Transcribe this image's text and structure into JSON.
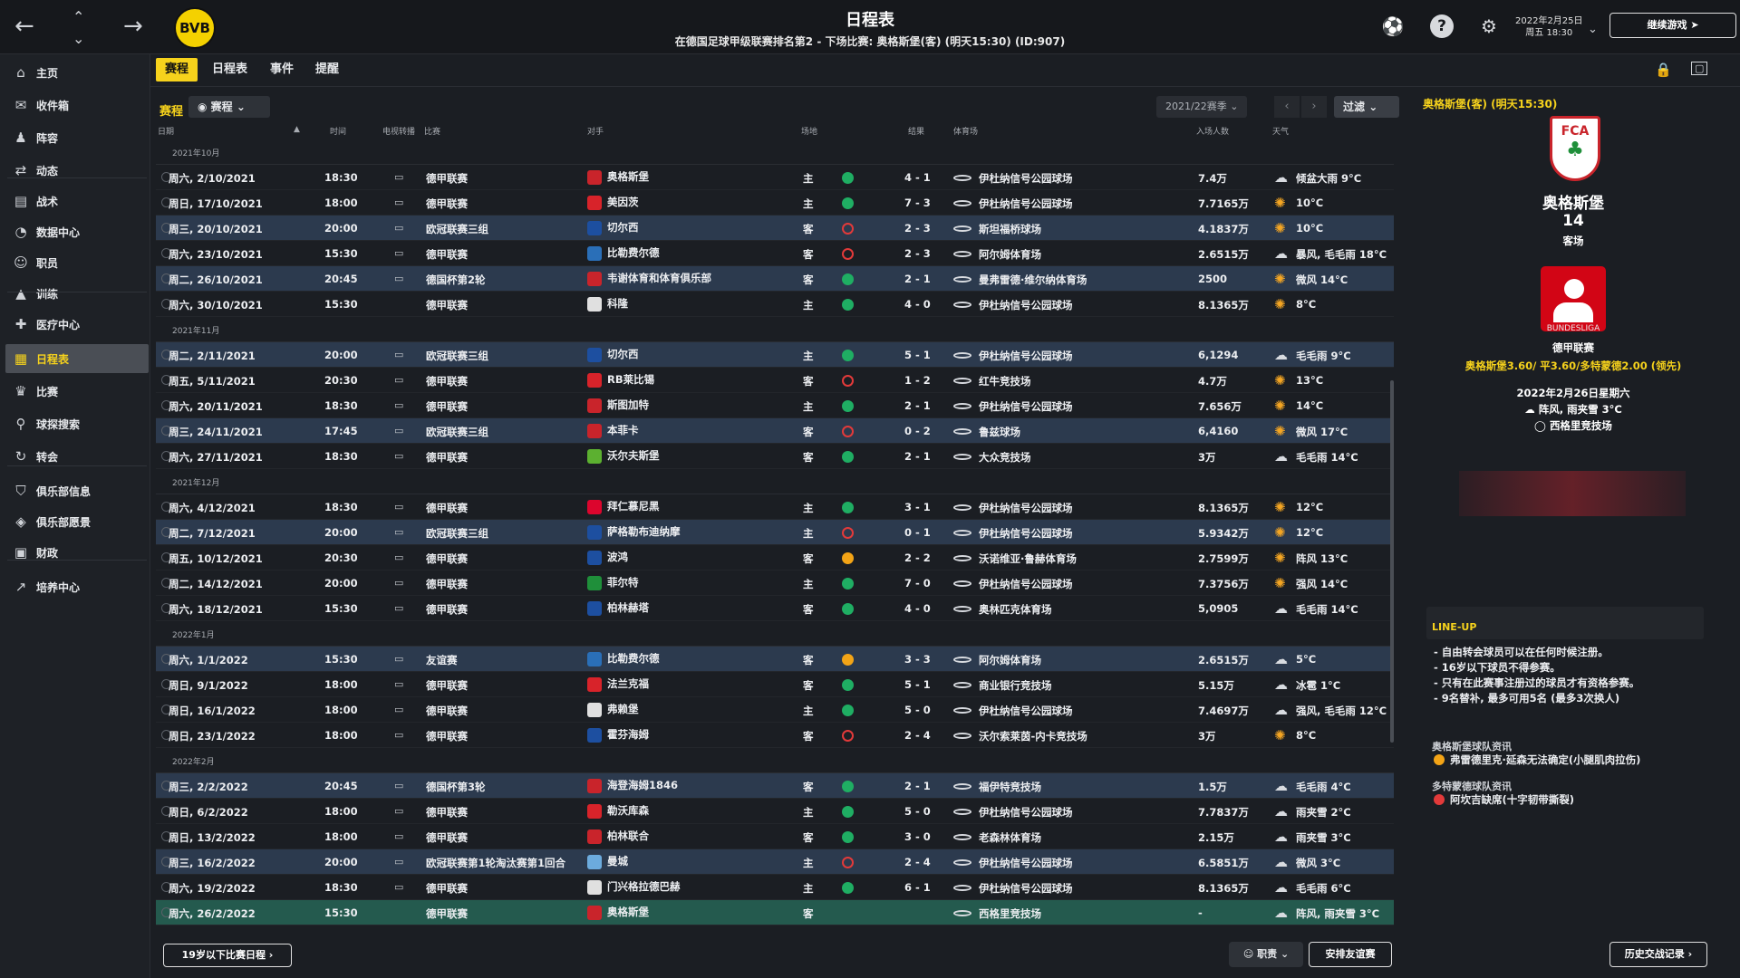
{
  "header": {
    "title": "日程表",
    "subtitle": "在德国足球甲级联赛排名第2 - 下场比赛: 奥格斯堡(客) (明天15:30) (ID:907)",
    "club_badge_text": "BVB",
    "game_date_line1": "2022年2月25日",
    "game_date_line2": "周五 18:30",
    "continue_label": "继续游戏"
  },
  "icons": {
    "back": "arrow-left-icon",
    "forward": "arrow-right-icon",
    "up": "chevron-up-icon",
    "down": "chevron-down-icon",
    "help": "help-icon",
    "settings": "gear-icon"
  },
  "sidebar": {
    "items": [
      {
        "label": "主页",
        "icon": "home-icon"
      },
      {
        "label": "收件箱",
        "icon": "inbox-icon"
      },
      {
        "label": "阵容",
        "icon": "squad-icon"
      },
      {
        "label": "动态",
        "icon": "dynamics-icon"
      },
      {
        "label": "战术",
        "icon": "tactics-icon"
      },
      {
        "label": "数据中心",
        "icon": "data-hub-icon"
      },
      {
        "label": "职员",
        "icon": "staff-icon"
      },
      {
        "label": "训练",
        "icon": "training-icon"
      },
      {
        "label": "医疗中心",
        "icon": "medical-icon"
      },
      {
        "label": "日程表",
        "icon": "calendar-icon"
      },
      {
        "label": "比赛",
        "icon": "trophy-icon"
      },
      {
        "label": "球探搜索",
        "icon": "search-icon"
      },
      {
        "label": "转会",
        "icon": "transfer-icon"
      },
      {
        "label": "俱乐部信息",
        "icon": "shield-icon"
      },
      {
        "label": "俱乐部愿景",
        "icon": "vision-icon"
      },
      {
        "label": "财政",
        "icon": "finance-icon"
      },
      {
        "label": "培养中心",
        "icon": "development-icon"
      }
    ],
    "active_index": 9
  },
  "tabs": [
    {
      "label": "赛程",
      "active": true
    },
    {
      "label": "日程表",
      "active": false
    },
    {
      "label": "事件",
      "active": false
    },
    {
      "label": "提醒",
      "active": false
    }
  ],
  "toolbar": {
    "section_label": "赛程",
    "view_label": "赛程",
    "season": "2021/22赛季",
    "filter_label": "过滤"
  },
  "columns": {
    "date": "日期",
    "time": "时间",
    "tv": "电视转播",
    "competition": "比赛",
    "opponent": "对手",
    "venue": "场地",
    "result": "结果",
    "stadium": "体育场",
    "attendance": "入场人数",
    "weather": "天气"
  },
  "months": [
    {
      "label": "2021年10月",
      "matches": [
        {
          "date": "周六, 2/10/2021",
          "time": "18:30",
          "tv": true,
          "comp": "德甲联赛",
          "opponent": "奥格斯堡",
          "crest": "#c9242b",
          "venue": "主",
          "result": "win",
          "score": "4 - 1",
          "stadium": "伊杜纳信号公园球场",
          "attendance": "7.4万",
          "weather_icon": "cloud",
          "weather": "倾盆大雨 9°C",
          "euro": false
        },
        {
          "date": "周日, 17/10/2021",
          "time": "18:00",
          "tv": true,
          "comp": "德甲联赛",
          "opponent": "美因茨",
          "crest": "#d8232a",
          "venue": "主",
          "result": "win",
          "score": "7 - 3",
          "stadium": "伊杜纳信号公园球场",
          "attendance": "7.7165万",
          "weather_icon": "sun",
          "weather": "10°C",
          "euro": false
        },
        {
          "date": "周三, 20/10/2021",
          "time": "20:00",
          "tv": true,
          "comp": "欧冠联赛三组",
          "opponent": "切尔西",
          "crest": "#1d4fa0",
          "venue": "客",
          "result": "loss",
          "score": "2 - 3",
          "stadium": "斯坦福桥球场",
          "attendance": "4.1837万",
          "weather_icon": "sun",
          "weather": "10°C",
          "euro": true
        },
        {
          "date": "周六, 23/10/2021",
          "time": "15:30",
          "tv": true,
          "comp": "德甲联赛",
          "opponent": "比勒费尔德",
          "crest": "#2a6fb8",
          "venue": "客",
          "result": "loss",
          "score": "2 - 3",
          "stadium": "阿尔姆体育场",
          "attendance": "2.6515万",
          "weather_icon": "cloud",
          "weather": "暴风, 毛毛雨 18°C",
          "euro": false
        },
        {
          "date": "周二, 26/10/2021",
          "time": "20:45",
          "tv": true,
          "comp": "德国杯第2轮",
          "opponent": "韦谢体育和体育俱乐部",
          "crest": "#c9242b",
          "venue": "客",
          "result": "win",
          "score": "2 - 1",
          "stadium": "曼弗雷德·维尔纳体育场",
          "attendance": "2500",
          "weather_icon": "sun",
          "weather": "微风 14°C",
          "euro": true
        },
        {
          "date": "周六, 30/10/2021",
          "time": "15:30",
          "tv": false,
          "comp": "德甲联赛",
          "opponent": "科隆",
          "crest": "#e0e0e0",
          "venue": "主",
          "result": "win",
          "score": "4 - 0",
          "stadium": "伊杜纳信号公园球场",
          "attendance": "8.1365万",
          "weather_icon": "sun",
          "weather": "8°C",
          "euro": false
        }
      ]
    },
    {
      "label": "2021年11月",
      "matches": [
        {
          "date": "周二, 2/11/2021",
          "time": "20:00",
          "tv": true,
          "comp": "欧冠联赛三组",
          "opponent": "切尔西",
          "crest": "#1d4fa0",
          "venue": "主",
          "result": "win",
          "score": "5 - 1",
          "stadium": "伊杜纳信号公园球场",
          "attendance": "6,1294",
          "weather_icon": "cloud",
          "weather": "毛毛雨 9°C",
          "euro": true
        },
        {
          "date": "周五, 5/11/2021",
          "time": "20:30",
          "tv": true,
          "comp": "德甲联赛",
          "opponent": "RB莱比锡",
          "crest": "#d8232a",
          "venue": "客",
          "result": "loss",
          "score": "1 - 2",
          "stadium": "红牛竞技场",
          "attendance": "4.7万",
          "weather_icon": "sun",
          "weather": "13°C",
          "euro": false
        },
        {
          "date": "周六, 20/11/2021",
          "time": "18:30",
          "tv": true,
          "comp": "德甲联赛",
          "opponent": "斯图加特",
          "crest": "#c9242b",
          "venue": "主",
          "result": "win",
          "score": "2 - 1",
          "stadium": "伊杜纳信号公园球场",
          "attendance": "7.656万",
          "weather_icon": "sun",
          "weather": "14°C",
          "euro": false
        },
        {
          "date": "周三, 24/11/2021",
          "time": "17:45",
          "tv": true,
          "comp": "欧冠联赛三组",
          "opponent": "本菲卡",
          "crest": "#c9242b",
          "venue": "客",
          "result": "loss",
          "score": "0 - 2",
          "stadium": "鲁兹球场",
          "attendance": "6,4160",
          "weather_icon": "sun",
          "weather": "微风 17°C",
          "euro": true
        },
        {
          "date": "周六, 27/11/2021",
          "time": "18:30",
          "tv": true,
          "comp": "德甲联赛",
          "opponent": "沃尔夫斯堡",
          "crest": "#5cb030",
          "venue": "客",
          "result": "win",
          "score": "2 - 1",
          "stadium": "大众竞技场",
          "attendance": "3万",
          "weather_icon": "cloud",
          "weather": "毛毛雨 14°C",
          "euro": false
        }
      ]
    },
    {
      "label": "2021年12月",
      "matches": [
        {
          "date": "周六, 4/12/2021",
          "time": "18:30",
          "tv": true,
          "comp": "德甲联赛",
          "opponent": "拜仁慕尼黑",
          "crest": "#dc052d",
          "venue": "主",
          "result": "win",
          "score": "3 - 1",
          "stadium": "伊杜纳信号公园球场",
          "attendance": "8.1365万",
          "weather_icon": "sun",
          "weather": "12°C",
          "euro": false
        },
        {
          "date": "周二, 7/12/2021",
          "time": "20:00",
          "tv": true,
          "comp": "欧冠联赛三组",
          "opponent": "萨格勒布迪纳摩",
          "crest": "#1d4fa0",
          "venue": "主",
          "result": "loss",
          "score": "0 - 1",
          "stadium": "伊杜纳信号公园球场",
          "attendance": "5.9342万",
          "weather_icon": "sun",
          "weather": "12°C",
          "euro": true
        },
        {
          "date": "周五, 10/12/2021",
          "time": "20:30",
          "tv": true,
          "comp": "德甲联赛",
          "opponent": "波鸿",
          "crest": "#1d4fa0",
          "venue": "客",
          "result": "draw",
          "score": "2 - 2",
          "stadium": "沃诺维亚·鲁赫体育场",
          "attendance": "2.7599万",
          "weather_icon": "sun",
          "weather": "阵风 13°C",
          "euro": false
        },
        {
          "date": "周二, 14/12/2021",
          "time": "20:00",
          "tv": true,
          "comp": "德甲联赛",
          "opponent": "菲尔特",
          "crest": "#1f8f3a",
          "venue": "主",
          "result": "win",
          "score": "7 - 0",
          "stadium": "伊杜纳信号公园球场",
          "attendance": "7.3756万",
          "weather_icon": "sun",
          "weather": "强风 14°C",
          "euro": false
        },
        {
          "date": "周六, 18/12/2021",
          "time": "15:30",
          "tv": true,
          "comp": "德甲联赛",
          "opponent": "柏林赫塔",
          "crest": "#1d4fa0",
          "venue": "客",
          "result": "win",
          "score": "4 - 0",
          "stadium": "奥林匹克体育场",
          "attendance": "5,0905",
          "weather_icon": "cloud",
          "weather": "毛毛雨 14°C",
          "euro": false
        }
      ]
    },
    {
      "label": "2022年1月",
      "matches": [
        {
          "date": "周六, 1/1/2022",
          "time": "15:30",
          "tv": true,
          "comp": "友谊赛",
          "opponent": "比勒费尔德",
          "crest": "#2a6fb8",
          "venue": "客",
          "result": "draw",
          "score": "3 - 3",
          "stadium": "阿尔姆体育场",
          "attendance": "2.6515万",
          "weather_icon": "cloud",
          "weather": "5°C",
          "euro": true
        },
        {
          "date": "周日, 9/1/2022",
          "time": "18:00",
          "tv": true,
          "comp": "德甲联赛",
          "opponent": "法兰克福",
          "crest": "#d8232a",
          "venue": "客",
          "result": "win",
          "score": "5 - 1",
          "stadium": "商业银行竞技场",
          "attendance": "5.15万",
          "weather_icon": "cloud",
          "weather": "冰雹 1°C",
          "euro": false
        },
        {
          "date": "周日, 16/1/2022",
          "time": "18:00",
          "tv": true,
          "comp": "德甲联赛",
          "opponent": "弗赖堡",
          "crest": "#e0e0e0",
          "venue": "主",
          "result": "win",
          "score": "5 - 0",
          "stadium": "伊杜纳信号公园球场",
          "attendance": "7.4697万",
          "weather_icon": "cloud",
          "weather": "强风, 毛毛雨 12°C",
          "euro": false
        },
        {
          "date": "周日, 23/1/2022",
          "time": "18:00",
          "tv": true,
          "comp": "德甲联赛",
          "opponent": "霍芬海姆",
          "crest": "#1d4fa0",
          "venue": "客",
          "result": "loss",
          "score": "2 - 4",
          "stadium": "沃尔索莱茵-内卡竞技场",
          "attendance": "3万",
          "weather_icon": "sun",
          "weather": "8°C",
          "euro": false
        }
      ]
    },
    {
      "label": "2022年2月",
      "matches": [
        {
          "date": "周三, 2/2/2022",
          "time": "20:45",
          "tv": true,
          "comp": "德国杯第3轮",
          "opponent": "海登海姆1846",
          "crest": "#c9242b",
          "venue": "客",
          "result": "win",
          "score": "2 - 1",
          "stadium": "福伊特竞技场",
          "attendance": "1.5万",
          "weather_icon": "cloud",
          "weather": "毛毛雨 4°C",
          "euro": true
        },
        {
          "date": "周日, 6/2/2022",
          "time": "18:00",
          "tv": true,
          "comp": "德甲联赛",
          "opponent": "勒沃库森",
          "crest": "#d8232a",
          "venue": "主",
          "result": "win",
          "score": "5 - 0",
          "stadium": "伊杜纳信号公园球场",
          "attendance": "7.7837万",
          "weather_icon": "cloud",
          "weather": "雨夹雪 2°C",
          "euro": false
        },
        {
          "date": "周日, 13/2/2022",
          "time": "18:00",
          "tv": true,
          "comp": "德甲联赛",
          "opponent": "柏林联合",
          "crest": "#c9242b",
          "venue": "客",
          "result": "win",
          "score": "3 - 0",
          "stadium": "老森林体育场",
          "attendance": "2.15万",
          "weather_icon": "cloud",
          "weather": "雨夹雪 3°C",
          "euro": false
        },
        {
          "date": "周三, 16/2/2022",
          "time": "20:00",
          "tv": true,
          "comp": "欧冠联赛第1轮淘汰赛第1回合",
          "opponent": "曼城",
          "crest": "#6cabdd",
          "venue": "主",
          "result": "loss",
          "score": "2 - 4",
          "stadium": "伊杜纳信号公园球场",
          "attendance": "6.5851万",
          "weather_icon": "cloud",
          "weather": "微风 3°C",
          "euro": true
        },
        {
          "date": "周六, 19/2/2022",
          "time": "18:30",
          "tv": true,
          "comp": "德甲联赛",
          "opponent": "门兴格拉德巴赫",
          "crest": "#e0e0e0",
          "venue": "主",
          "result": "win",
          "score": "6 - 1",
          "stadium": "伊杜纳信号公园球场",
          "attendance": "8.1365万",
          "weather_icon": "cloud",
          "weather": "毛毛雨 6°C",
          "euro": false
        },
        {
          "date": "周六, 26/2/2022",
          "time": "15:30",
          "tv": false,
          "comp": "德甲联赛",
          "opponent": "奥格斯堡",
          "crest": "#c9242b",
          "venue": "客",
          "result": "",
          "score": "",
          "stadium": "西格里竞技场",
          "attendance": "-",
          "weather_icon": "cloud",
          "weather": "阵风, 雨夹雪 3°C",
          "euro": false,
          "next": true
        }
      ]
    }
  ],
  "bottom": {
    "u19_label": "19岁以下比赛日程",
    "duty_label": "职责",
    "friendly_label": "安排友谊赛",
    "h2h_label": "历史交战记录"
  },
  "next_match": {
    "header": "奥格斯堡(客) (明天15:30)",
    "crest_text": "FCA",
    "opponent": "奥格斯堡",
    "position": "14",
    "venue_label": "客场",
    "league_logo_text": "BUNDESLIGA",
    "competition": "德甲联赛",
    "odds": "奥格斯堡3.60/ 平3.60/多特蒙德2.00 (领先)",
    "date": "2022年2月26日星期六",
    "weather": "阵风, 雨夹雪 3°C",
    "stadium": "西格里竞技场",
    "lineup_title": "LINE-UP",
    "rules": [
      "- 自由转会球员可以在任何时候注册。",
      "- 16岁以下球员不得参赛。",
      "- 只有在此赛事注册过的球员才有资格参赛。",
      "- 9名替补, 最多可用5名 (最多3次换人)"
    ],
    "news": [
      {
        "title": "奥格斯堡球队资讯",
        "text": "弗雷德里克·延森无法确定(小腿肌肉拉伤)",
        "color": "orange"
      },
      {
        "title": "多特蒙德球队资讯",
        "text": "阿坎吉缺席(十字韧带撕裂)",
        "color": "red"
      }
    ]
  }
}
